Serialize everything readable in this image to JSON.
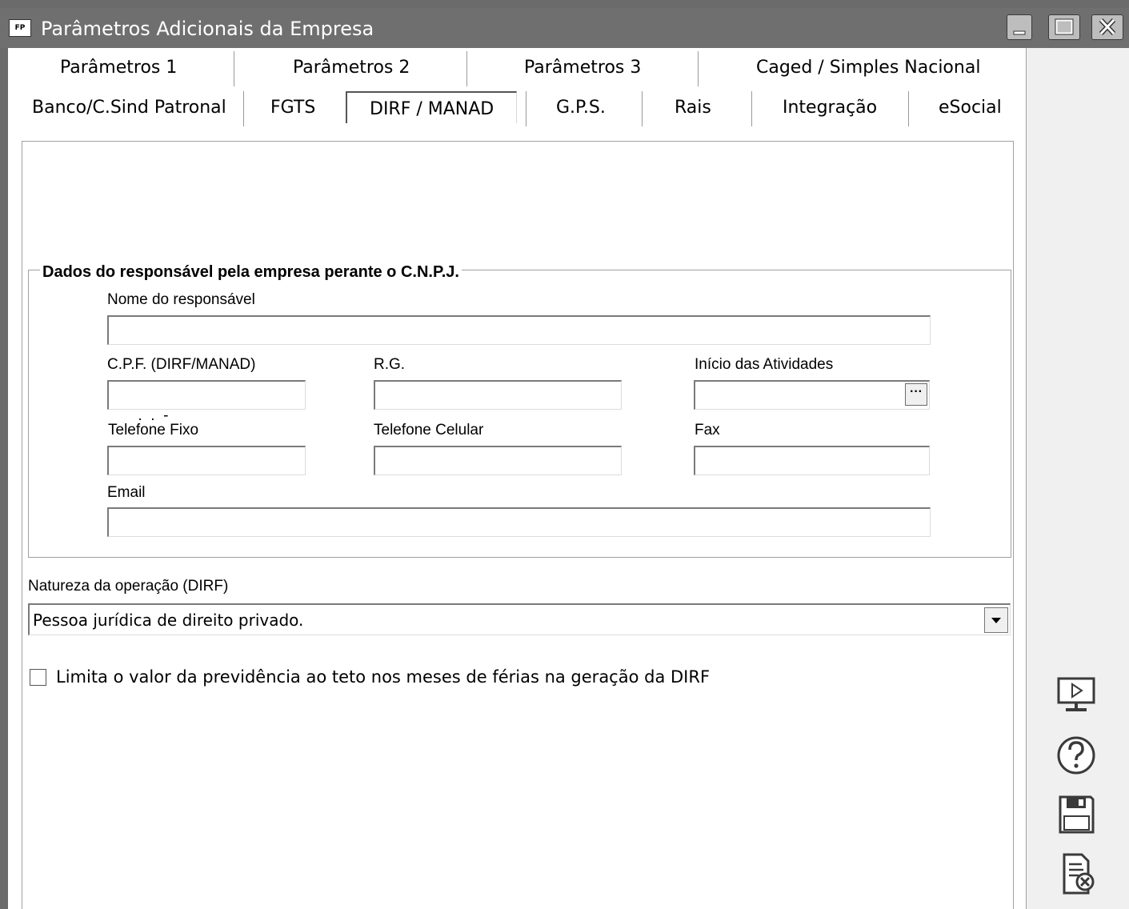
{
  "window": {
    "title": "Parâmetros Adicionais da Empresa",
    "app_badge": "FP"
  },
  "tabs_row1": [
    {
      "label": "Parâmetros 1"
    },
    {
      "label": "Parâmetros 2"
    },
    {
      "label": "Parâmetros 3"
    },
    {
      "label": "Caged / Simples Nacional"
    }
  ],
  "tabs_row2": [
    {
      "label": "Banco/C.Sind Patronal"
    },
    {
      "label": "FGTS"
    },
    {
      "label": "DIRF / MANAD",
      "active": true
    },
    {
      "label": "G.P.S."
    },
    {
      "label": "Rais"
    },
    {
      "label": "Integração"
    },
    {
      "label": "eSocial"
    }
  ],
  "group": {
    "title": "Dados do responsável pela empresa perante o C.N.P.J.",
    "nome_label": "Nome do responsável",
    "nome_value": "",
    "cpf_label": "C.P.F. (DIRF/MANAD)",
    "cpf_value": " .  .  -",
    "rg_label": "R.G.",
    "rg_value": "",
    "inicio_label": "Início das Atividades",
    "inicio_value": "",
    "inicio_button": "···",
    "tel_fixo_label": "Telefone Fixo",
    "tel_fixo_value": "",
    "tel_cel_label": "Telefone Celular",
    "tel_cel_value": "",
    "fax_label": "Fax",
    "fax_value": "",
    "email_label": "Email",
    "email_value": ""
  },
  "natureza": {
    "label": "Natureza da operação (DIRF)",
    "selected": "Pessoa jurídica de direito privado."
  },
  "checkbox": {
    "label": "Limita o valor da previdência ao teto nos meses de férias na geração da DIRF",
    "checked": false
  },
  "side_icons": [
    "monitor-play-icon",
    "help-icon",
    "save-icon",
    "cancel-document-icon"
  ]
}
